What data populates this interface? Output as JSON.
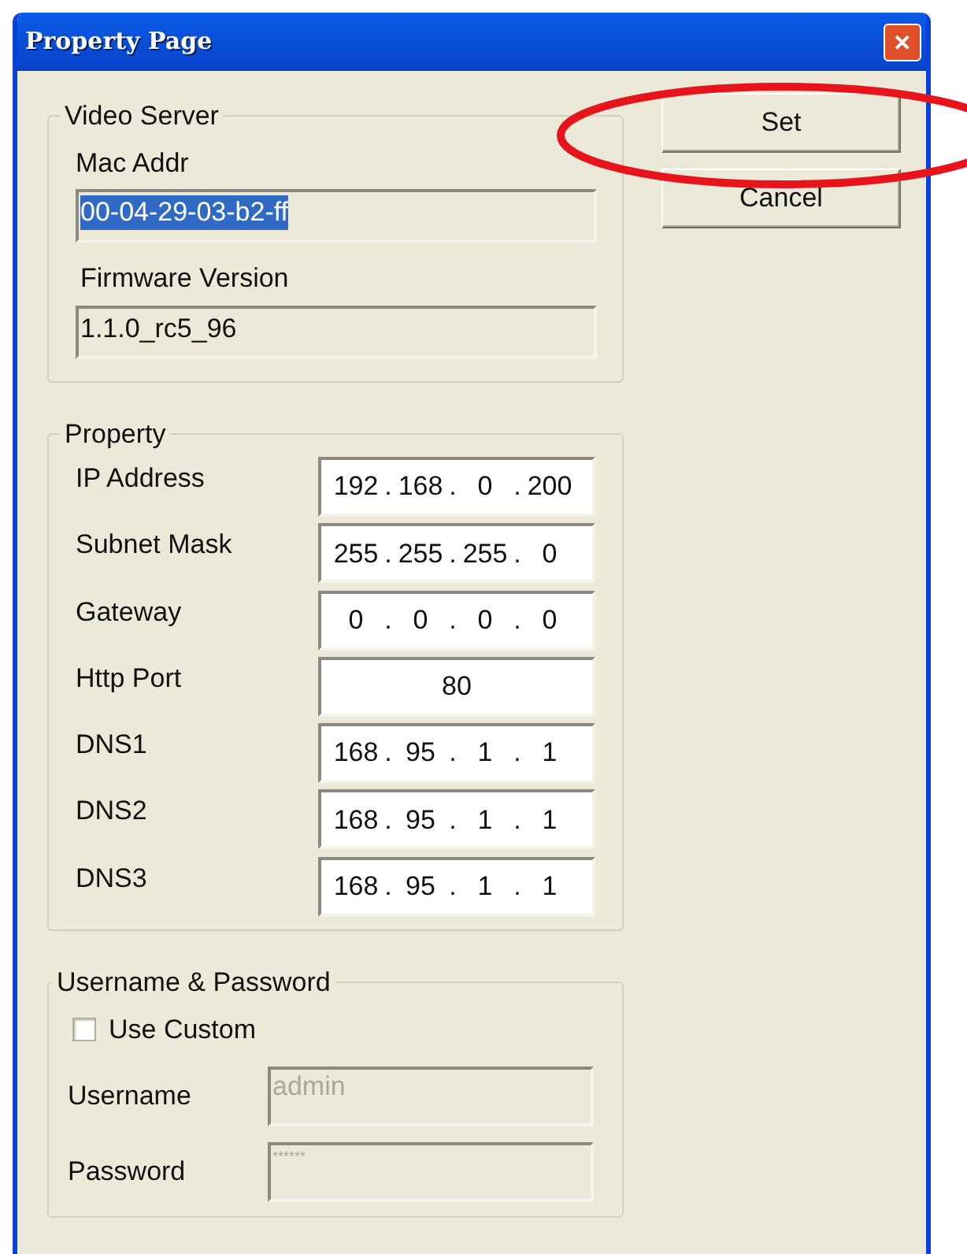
{
  "window": {
    "title": "Property Page",
    "close": "✕"
  },
  "video_server": {
    "legend": "Video Server",
    "fields": [
      {
        "label": "Mac Addr",
        "value": "00-04-29-03-b2-ff",
        "selected": true
      },
      {
        "label": "Firmware Version",
        "value": "1.1.0_rc5_96",
        "selected": false
      }
    ]
  },
  "buttons": [
    {
      "label": "Set",
      "circled": true
    },
    {
      "label": "Cancel",
      "circled": false
    }
  ],
  "property": {
    "legend": "Property",
    "fields": [
      {
        "label": "IP Address",
        "kind": "ip",
        "separator": ".",
        "octets": [
          "192",
          "168",
          "0",
          "200"
        ]
      },
      {
        "label": "Subnet Mask",
        "kind": "ip",
        "separator": ".",
        "octets": [
          "255",
          "255",
          "255",
          "0"
        ]
      },
      {
        "label": "Gateway",
        "kind": "ip",
        "separator": ".",
        "octets": [
          "0",
          "0",
          "0",
          "0"
        ]
      },
      {
        "label": "Http Port",
        "kind": "number",
        "value": "80"
      },
      {
        "label": "DNS1",
        "kind": "ip",
        "separator": ".",
        "octets": [
          "168",
          "95",
          "1",
          "1"
        ]
      },
      {
        "label": "DNS2",
        "kind": "ip",
        "separator": ".",
        "octets": [
          "168",
          "95",
          "1",
          "1"
        ]
      },
      {
        "label": "DNS3",
        "kind": "ip",
        "separator": ".",
        "octets": [
          "168",
          "95",
          "1",
          "1"
        ]
      }
    ]
  },
  "credentials": {
    "legend": "Username & Password",
    "use_custom": {
      "label": "Use Custom",
      "checked": false
    },
    "fields": [
      {
        "label": "Username",
        "value": "admin",
        "disabled": true
      },
      {
        "label": "Password",
        "value": "******",
        "disabled": true
      }
    ]
  }
}
